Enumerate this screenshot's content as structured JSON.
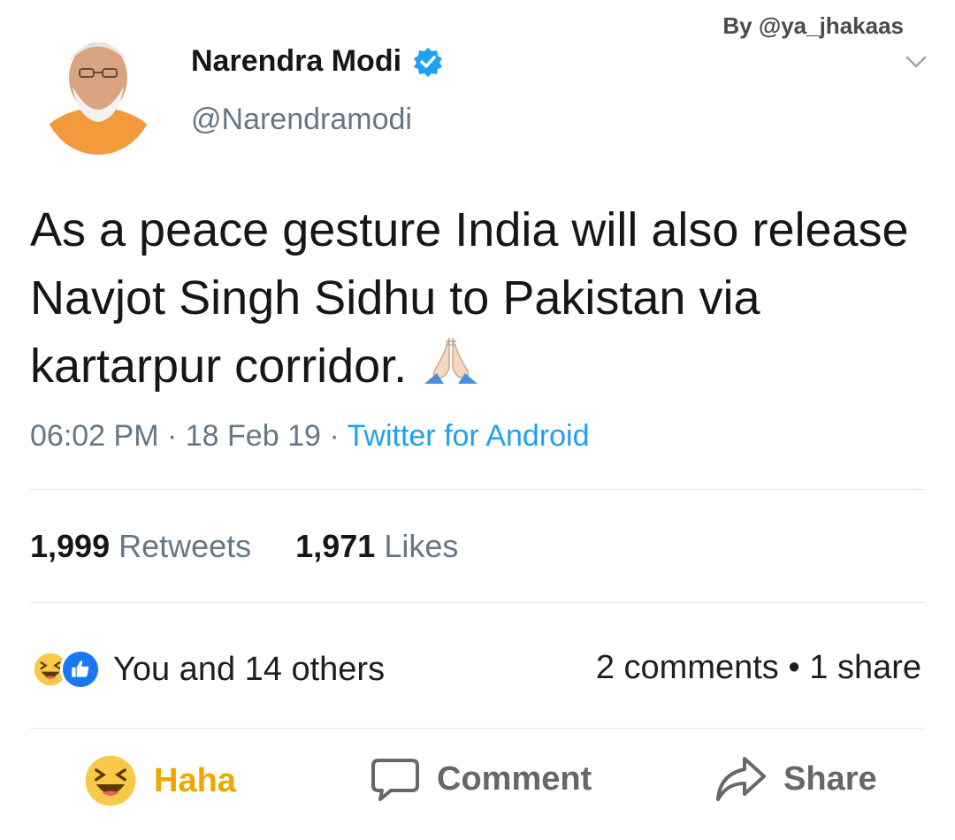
{
  "watermark": "By @ya_jhakaas",
  "tweet": {
    "author_name": "Narendra Modi",
    "author_handle": "@Narendramodi",
    "text": "As a peace gesture India will also release Navjot Singh Sidhu to Pakistan via kartarpur corridor.",
    "time": "06:02 PM",
    "date": "18 Feb 19",
    "source": "Twitter for Android",
    "retweets_count": "1,999",
    "retweets_label": "Retweets",
    "likes_count": "1,971",
    "likes_label": "Likes"
  },
  "facebook": {
    "reactions_text": "You and 14 others",
    "comments_text": "2 comments",
    "shares_text": "1 share",
    "actions": {
      "haha": "Haha",
      "comment": "Comment",
      "share": "Share"
    }
  },
  "colors": {
    "twitter_blue": "#1da1f2",
    "haha_yellow": "#f0a500",
    "fb_blue": "#1877f2",
    "muted_gray": "#657786"
  },
  "icons": [
    "verified-badge-icon",
    "chevron-down-icon",
    "praying-hands-emoji",
    "haha-reaction-icon",
    "like-reaction-icon",
    "comment-icon",
    "share-icon"
  ]
}
